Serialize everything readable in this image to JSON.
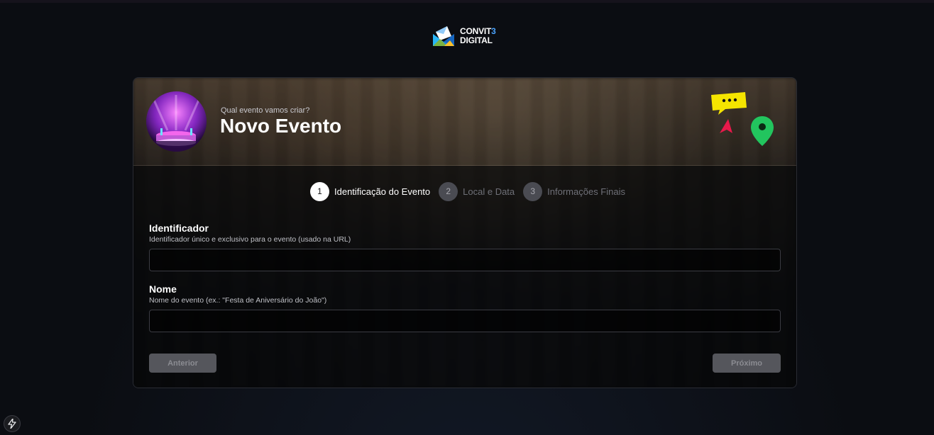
{
  "brand": {
    "line1": "CONVIT",
    "line1_accent": "3",
    "line2": "DIGITAL"
  },
  "header": {
    "subtitle": "Qual evento vamos criar?",
    "title": "Novo Evento"
  },
  "stepper": {
    "steps": [
      {
        "number": "1",
        "label": "Identificação do Evento",
        "state": "active"
      },
      {
        "number": "2",
        "label": "Local e Data",
        "state": "inactive"
      },
      {
        "number": "3",
        "label": "Informações Finais",
        "state": "inactive"
      }
    ]
  },
  "form": {
    "identifier": {
      "label": "Identificador",
      "help": "Identificador único e exclusivo para o evento (usado na URL)",
      "value": "",
      "placeholder": ""
    },
    "name": {
      "label": "Nome",
      "help": "Nome do evento (ex.: \"Festa de Aniversário do João\")",
      "value": "",
      "placeholder": ""
    }
  },
  "buttons": {
    "previous": "Anterior",
    "next": "Próximo"
  },
  "colors": {
    "accent": "#4aa3ff",
    "chat_bubble": "#f5e500",
    "pin": "#22c55e",
    "arrow": "#e8194b",
    "avatar": "#c44be0"
  }
}
